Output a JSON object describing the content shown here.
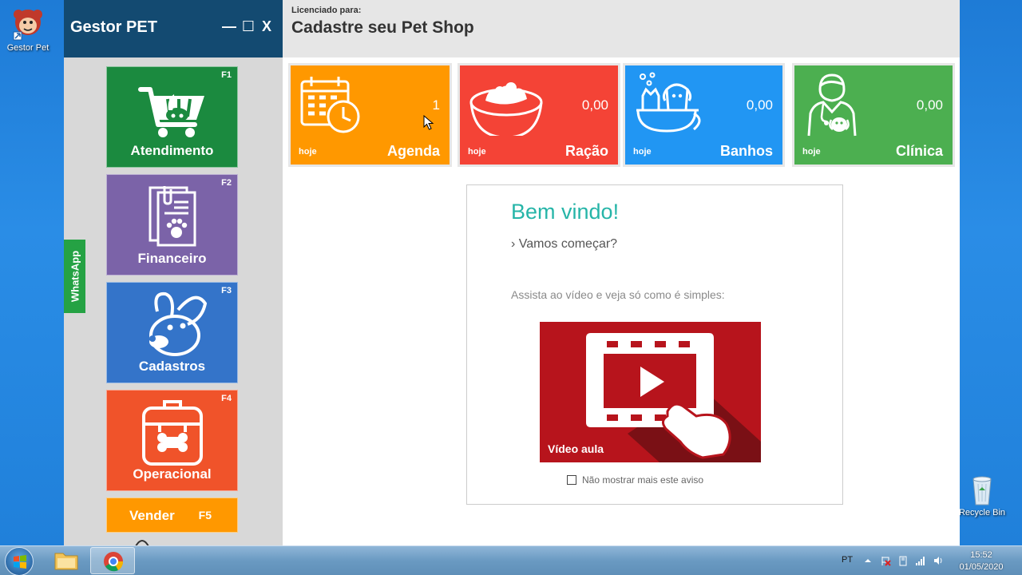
{
  "desktop": {
    "app_shortcut_label": "Gestor Pet",
    "recycle_bin_label": "Recycle Bin"
  },
  "app": {
    "title": "Gestor PET",
    "window_controls": {
      "minimize": "—",
      "maximize": "☐",
      "close": "X"
    },
    "license_label": "Licenciado para:",
    "license_name": "Cadastre seu Pet Shop"
  },
  "sidebar": {
    "whatsapp_label": "WhatsApp",
    "tiles": [
      {
        "label": "Atendimento",
        "key": "F1",
        "color": "#1b8a3f"
      },
      {
        "label": "Financeiro",
        "key": "F2",
        "color": "#7b63a8"
      },
      {
        "label": "Cadastros",
        "key": "F3",
        "color": "#3474c9"
      },
      {
        "label": "Operacional",
        "key": "F4",
        "color": "#f0532a"
      }
    ],
    "vender": {
      "label": "Vender",
      "key": "F5",
      "color": "#ff9800"
    }
  },
  "stats": [
    {
      "label": "Agenda",
      "value": "1",
      "period": "hoje",
      "color": "#ff9800",
      "icon": "calendar-clock-icon"
    },
    {
      "label": "Ração",
      "value": "0,00",
      "period": "hoje",
      "color": "#f44336",
      "icon": "food-bowl-icon"
    },
    {
      "label": "Banhos",
      "value": "0,00",
      "period": "hoje",
      "color": "#2196f3",
      "icon": "bath-pets-icon"
    },
    {
      "label": "Clínica",
      "value": "0,00",
      "period": "hoje",
      "color": "#4caf50",
      "icon": "vet-doctor-icon"
    }
  ],
  "welcome": {
    "title": "Bem vindo!",
    "subtitle": "› Vamos começar?",
    "instruction": "Assista ao vídeo e veja só como é simples:",
    "video_label": "Vídeo aula",
    "checkbox_label": "Não mostrar mais este aviso",
    "title_color": "#26b5a8"
  },
  "taskbar": {
    "language": "PT",
    "time": "15:52",
    "date": "01/05/2020"
  }
}
